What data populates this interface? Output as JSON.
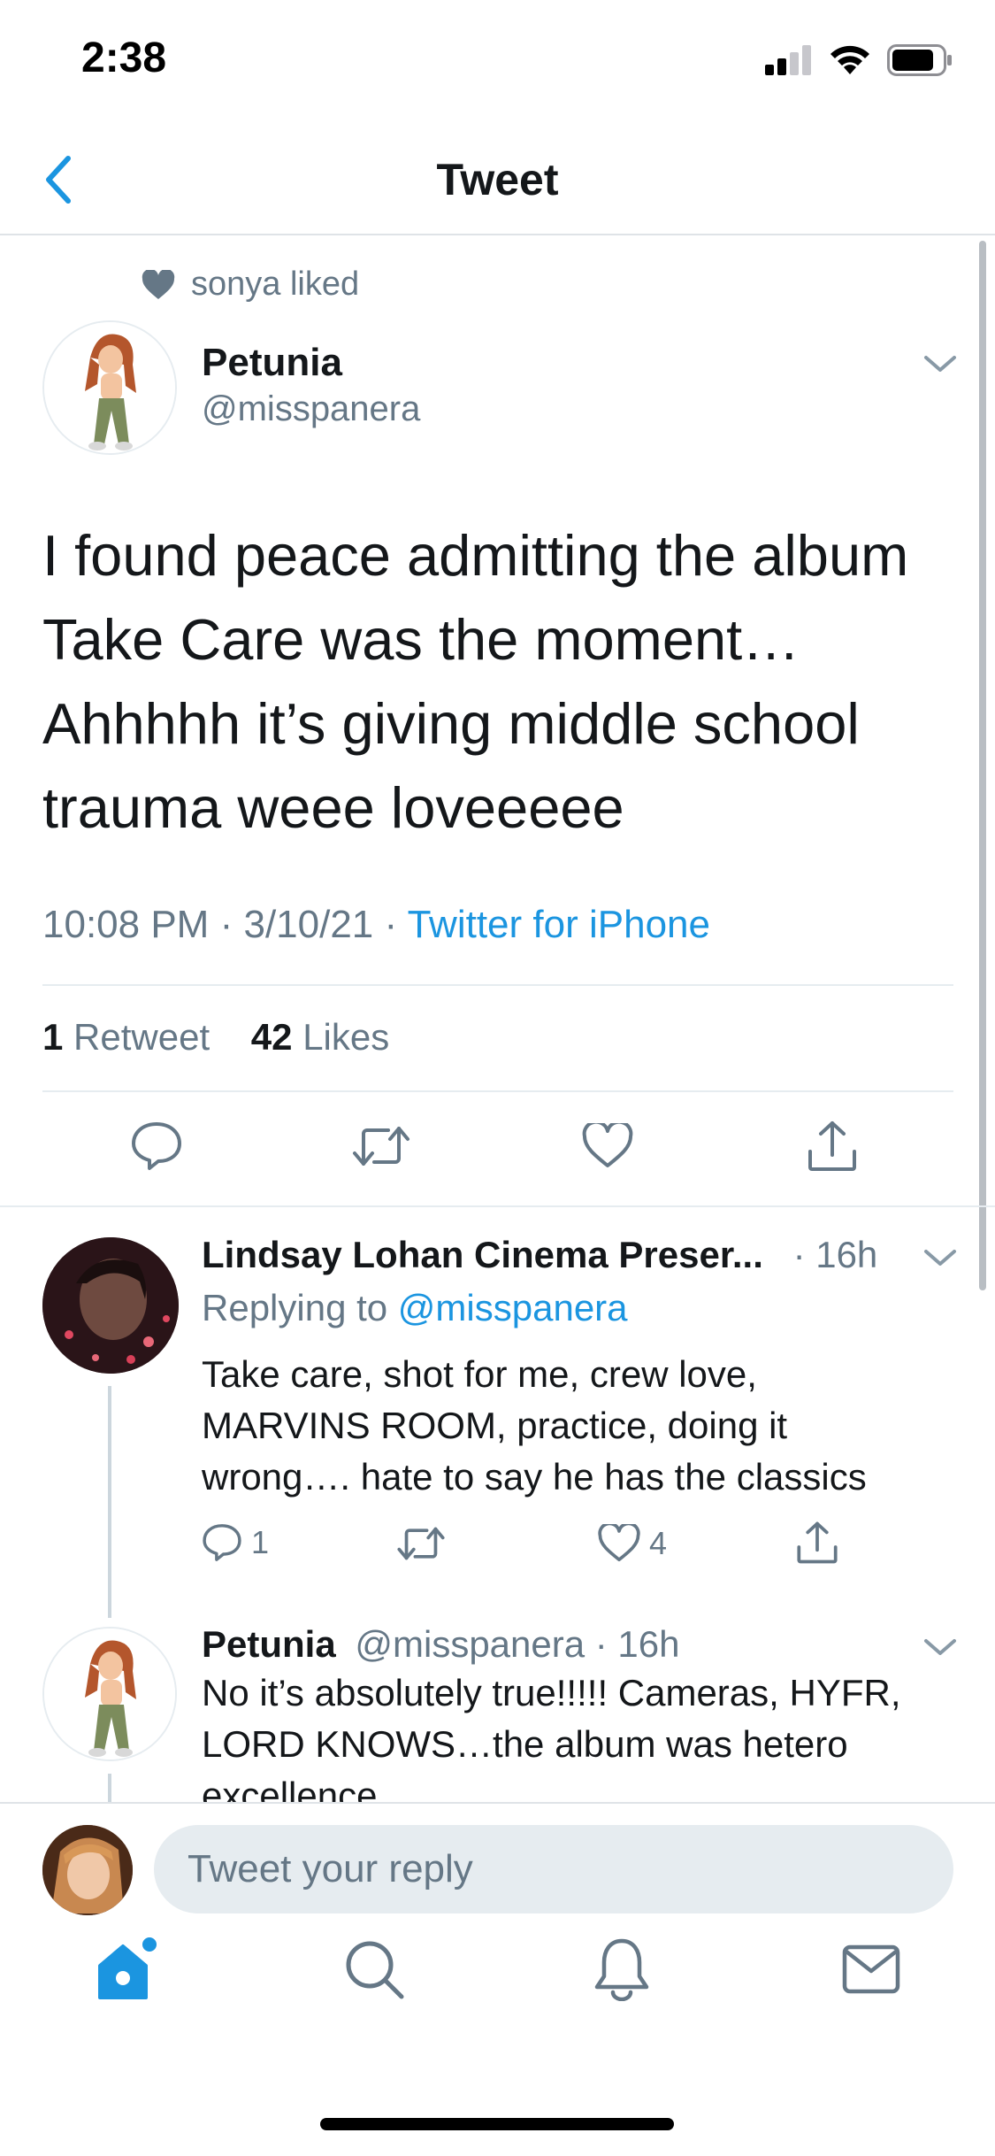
{
  "status_bar": {
    "time": "2:38"
  },
  "nav": {
    "title": "Tweet"
  },
  "main_tweet": {
    "liked_by": "sonya liked",
    "author_name": "Petunia",
    "author_handle": "@misspanera",
    "text": "I found peace admitting the album Take Care was the moment…Ahhhhh it’s giving middle school trauma weee loveeeee",
    "time": "10:08 PM",
    "date": "3/10/21",
    "source": "Twitter for iPhone",
    "retweet_count": "1",
    "retweet_label": "Retweet",
    "like_count": "42",
    "like_label": "Likes"
  },
  "replies": [
    {
      "author_name": "Lindsay Lohan Cinema Preser...",
      "meta": "· 16h",
      "replying_prefix": "Replying to",
      "replying_to": "@misspanera",
      "text": "Take care, shot for me, crew love, MARVINS ROOM, practice, doing it wrong…. hate to say he has the classics",
      "reply_count": "1",
      "like_count": "4"
    },
    {
      "author_name": "Petunia",
      "meta": "@misspanera · 16h",
      "text": "No it’s absolutely true!!!!! Cameras, HYFR, LORD KNOWS…the album was hetero excellence"
    }
  ],
  "composer": {
    "placeholder": "Tweet your reply"
  },
  "colors": {
    "accent": "#1b95e0",
    "muted": "#657786",
    "divider": "#e6ecf0"
  },
  "icons": [
    "back-icon",
    "heart-icon",
    "chevron-down-icon",
    "reply-icon",
    "retweet-icon",
    "like-icon",
    "share-icon",
    "home-icon",
    "search-icon",
    "notifications-icon",
    "messages-icon"
  ]
}
